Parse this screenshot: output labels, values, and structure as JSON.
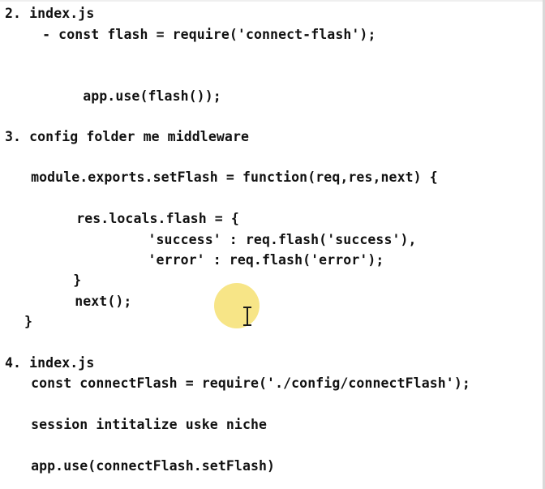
{
  "document": {
    "lines": [
      "2. index.js",
      "   - const flash = require('connect-flash');",
      "      app.use(flash());",
      "3. config folder me middleware",
      "  module.exports.setFlash = function(req,res,next) {",
      "      res.locals.flash = {",
      "              'success' : req.flash('success'),",
      "              'error' : req.flash('error');",
      "      }",
      "      next();",
      " }",
      "4. index.js",
      "  const connectFlash = require('./config/connectFlash');",
      "  session intitalize uske niche",
      "  app.use(connectFlash.setFlash)"
    ]
  },
  "cursor": {
    "icon": "text-ibeam-cursor-icon",
    "highlight_color": "#f6e27a"
  }
}
